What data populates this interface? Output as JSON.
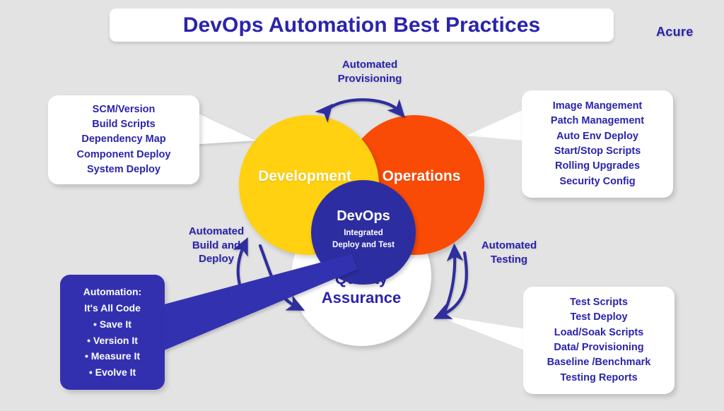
{
  "header": {
    "title": "DevOps Automation Best Practices",
    "brand": "Acure"
  },
  "colors": {
    "background": "#e3e3e3",
    "brand_blue": "#2a24ac",
    "deep_blue": "#2d2da2",
    "box_blue": "#3330b0",
    "development_yellow": "#ffd110",
    "operations_orange": "#fa4b06",
    "qa_white": "#ffffff",
    "arrow_blue": "#2f2f9c"
  },
  "venn": {
    "development": {
      "label": "Development"
    },
    "operations": {
      "label": "Operations"
    },
    "quality_assurance": {
      "label_line1": "Quality",
      "label_line2": "Assurance"
    },
    "center": {
      "title": "DevOps",
      "sub_line1": "Integrated",
      "sub_line2": "Deploy and Test"
    }
  },
  "callouts": {
    "development": {
      "items": [
        "SCM/Version",
        "Build Scripts",
        "Dependency Map",
        "Component Deploy",
        "System Deploy"
      ]
    },
    "operations": {
      "items": [
        "Image Mangement",
        "Patch Management",
        "Auto Env Deploy",
        "Start/Stop Scripts",
        "Rolling Upgrades",
        "Security Config"
      ]
    },
    "quality_assurance": {
      "items": [
        "Test Scripts",
        "Test Deploy",
        "Load/Soak Scripts",
        "Data/ Provisioning",
        "Baseline /Benchmark",
        "Testing Reports"
      ]
    },
    "automation": {
      "heading": "Automation:",
      "subheading": "It's All Code",
      "bullets": [
        "• Save It",
        "• Version It",
        "• Measure It",
        "• Evolve It"
      ]
    }
  },
  "arc_labels": {
    "provisioning": {
      "line1": "Automated",
      "line2": "Provisioning"
    },
    "build_deploy": {
      "line1": "Automated",
      "line2": "Build and",
      "line3": "Deploy"
    },
    "testing": {
      "line1": "Automated",
      "line2": "Testing"
    }
  }
}
